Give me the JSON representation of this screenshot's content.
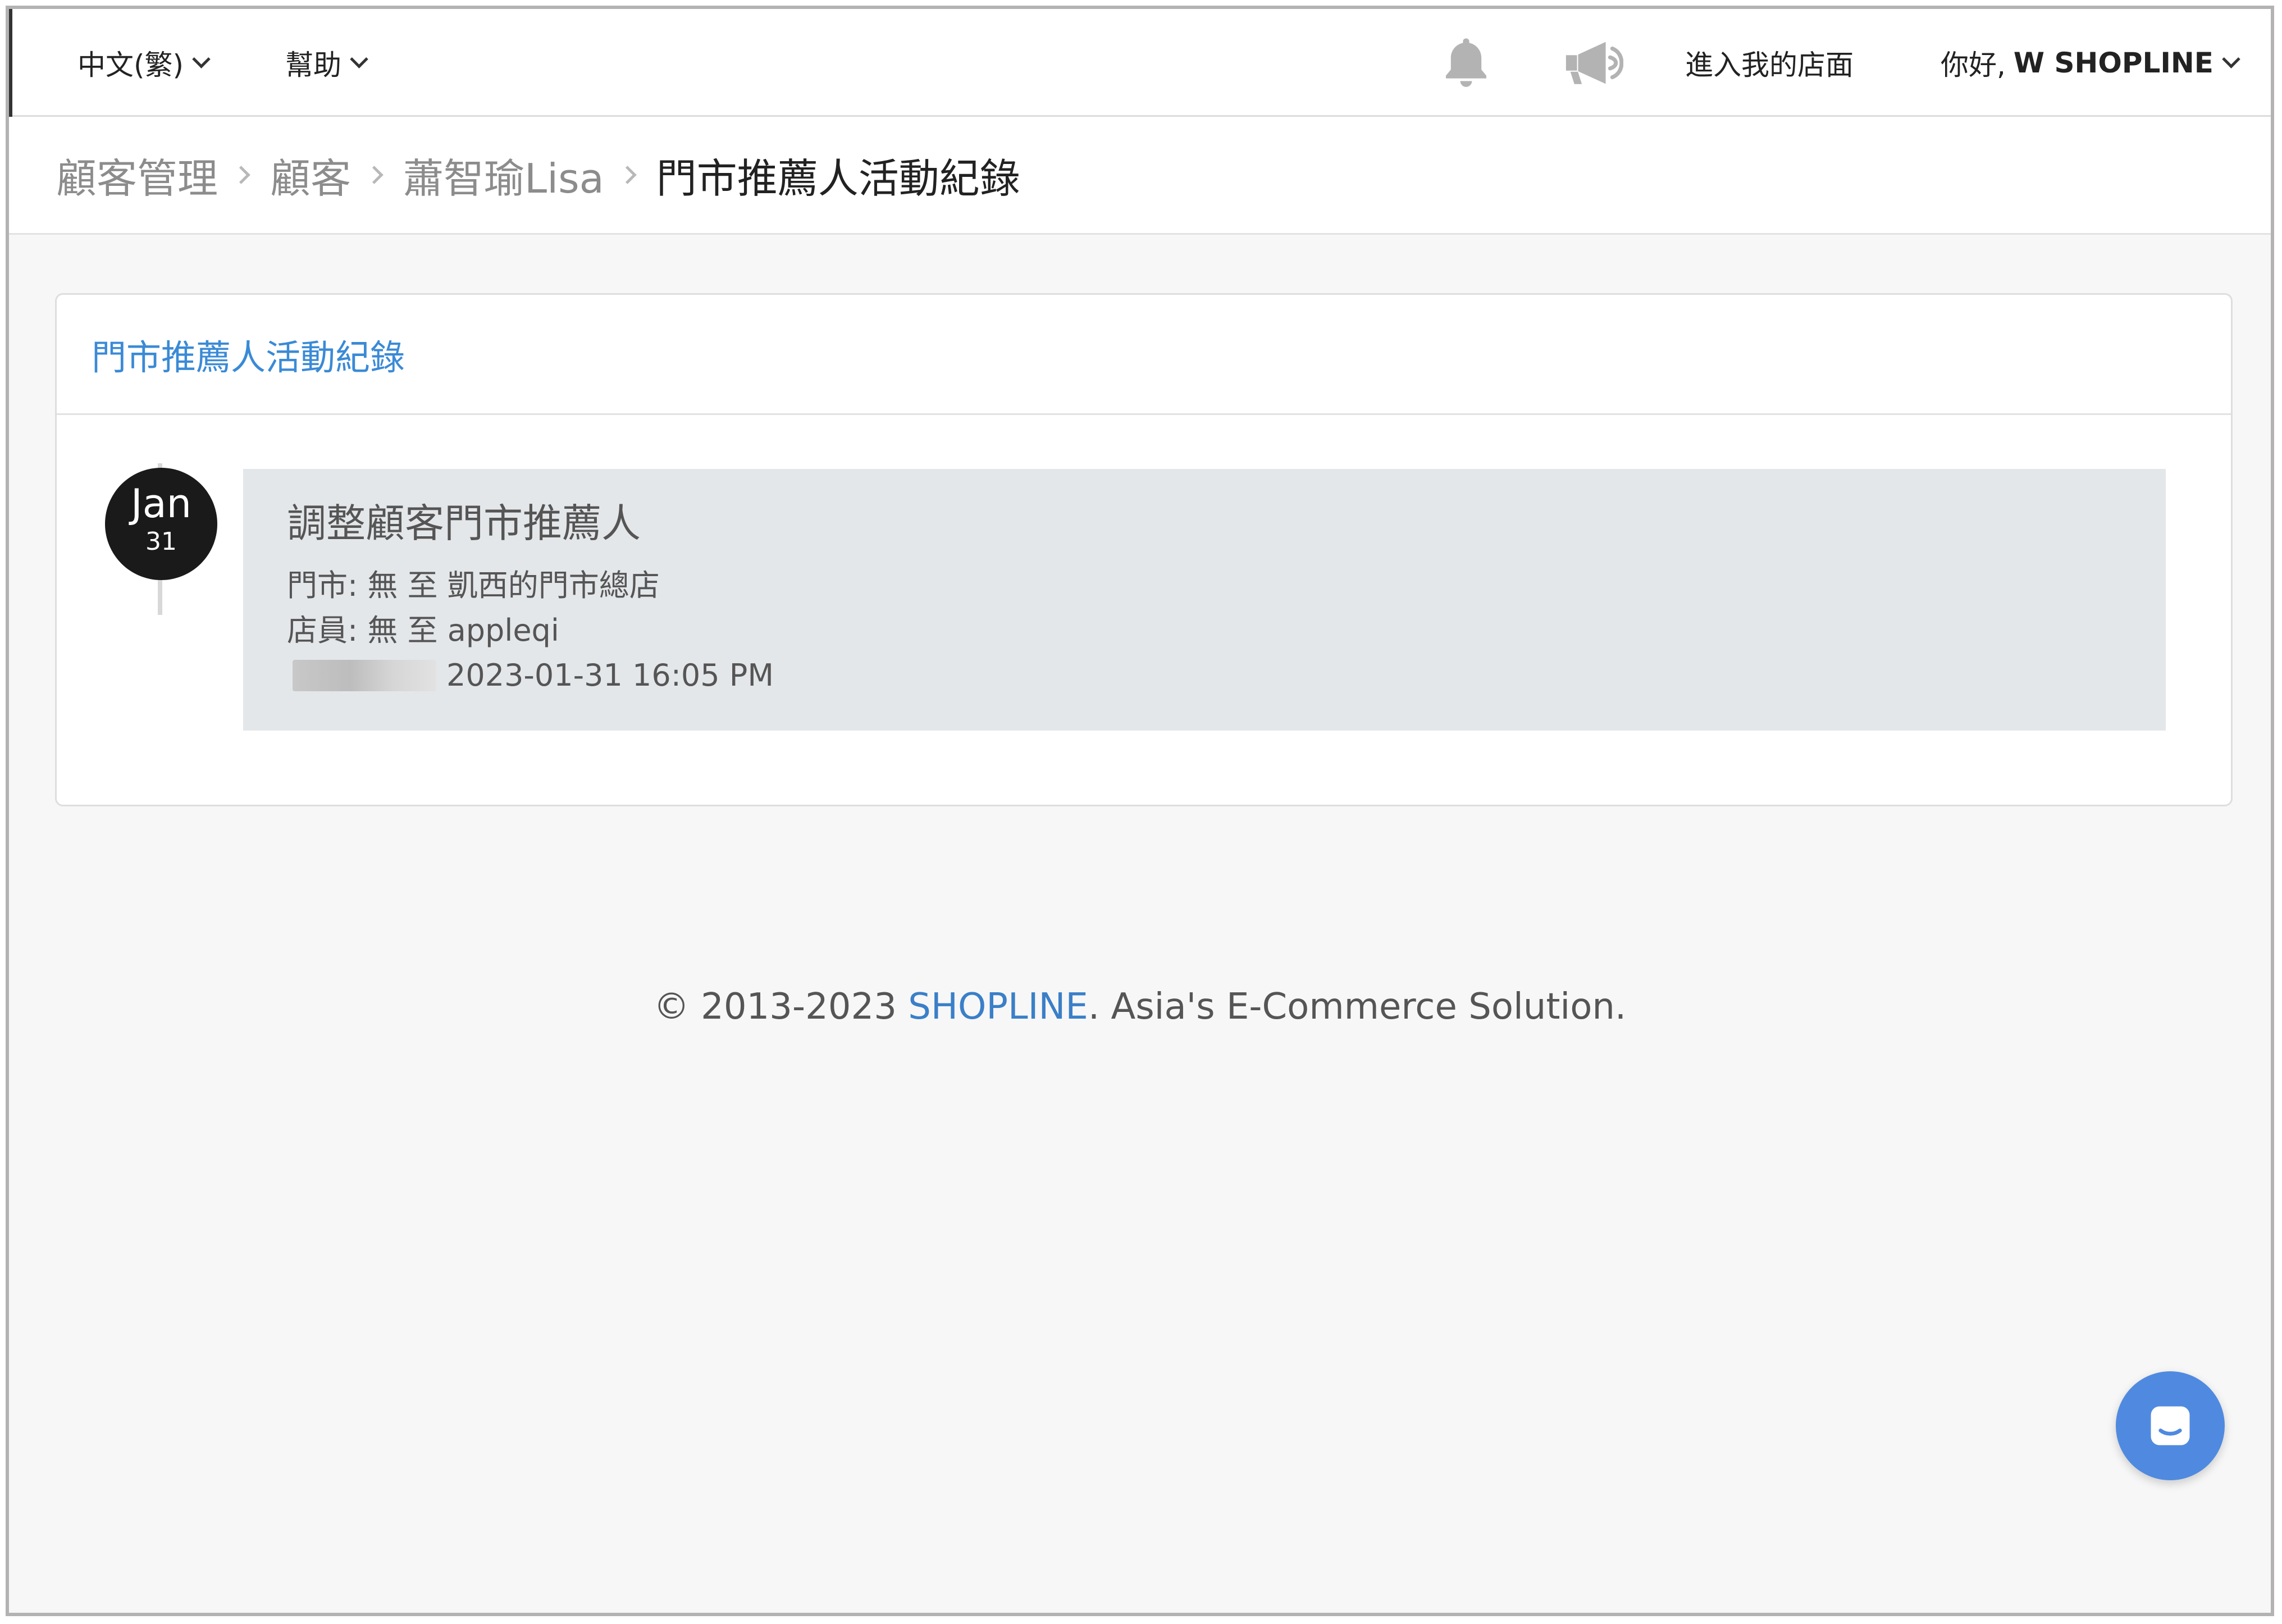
{
  "navbar": {
    "language_label": "中文(繁)",
    "help_label": "幫助",
    "notifications_icon": "bell-icon",
    "announcements_icon": "megaphone-icon",
    "store_link_label": "進入我的店面",
    "greeting": "你好,",
    "user_name": "W SHOPLINE"
  },
  "breadcrumb": {
    "items": [
      {
        "label": "顧客管理"
      },
      {
        "label": "顧客"
      },
      {
        "label": "蕭智瑜Lisa"
      },
      {
        "label": "門市推薦人活動紀錄"
      }
    ]
  },
  "panel": {
    "title": "門市推薦人活動紀錄",
    "entries": [
      {
        "month": "Jan",
        "day": "31",
        "title": "調整顧客門市推薦人",
        "store_line": "門市: 無 至 凱西的門市總店",
        "staff_line": "店員: 無 至 appleqi",
        "timestamp": "2023-01-31 16:05 PM"
      }
    ]
  },
  "footer": {
    "copyright": "© 2013-2023 ",
    "brand": "SHOPLINE",
    "tagline": ". Asia's E-Commerce Solution."
  },
  "chat": {
    "icon": "chat-bubble-icon"
  },
  "colors": {
    "accent_blue": "#3a8ad6",
    "chat_button": "#4f8ae0",
    "date_badge": "#1a1a1a",
    "card_background": "#e4e7ea"
  }
}
